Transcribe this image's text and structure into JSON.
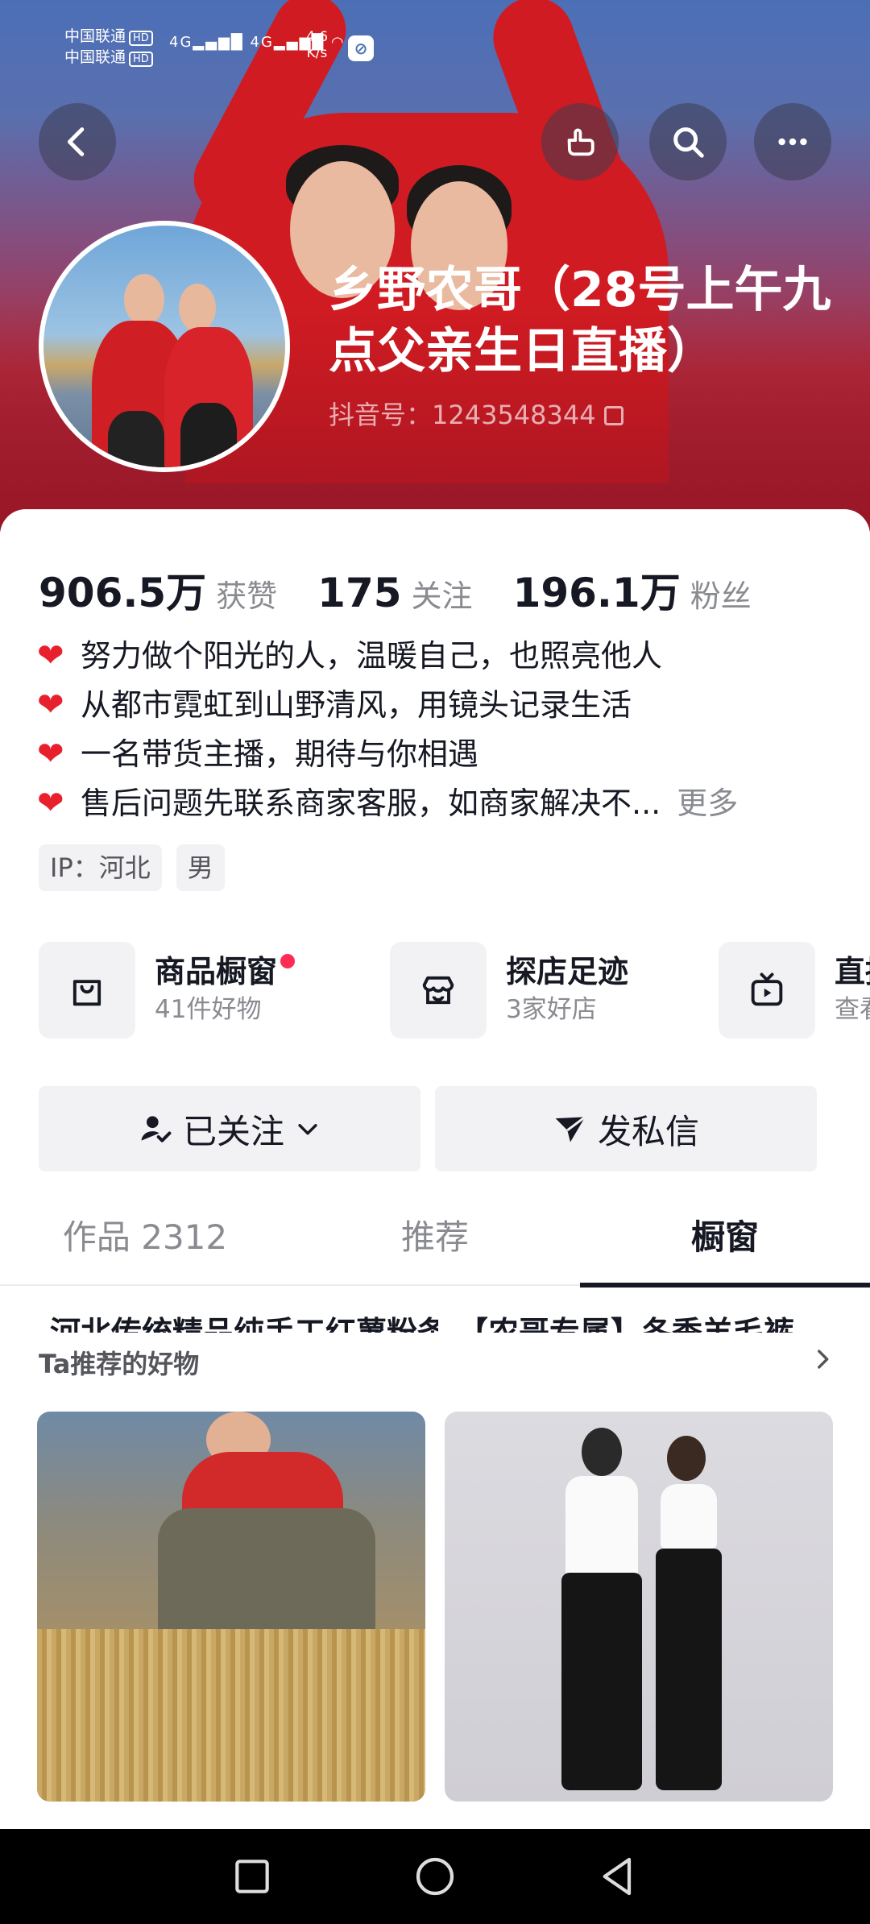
{
  "status_bar": {
    "carrier_1": "中国联通",
    "carrier_2": "中国联通",
    "hd_badge": "HD",
    "network": "4G",
    "speed_value": "4.6",
    "speed_unit": "K/s"
  },
  "header": {
    "nickname": "乡野农哥（28号上午九点父亲生日直播）",
    "douyin_id": "抖音号：1243548344"
  },
  "stats": {
    "likes_value": "906.5万",
    "likes_label": "获赞",
    "following_value": "175",
    "following_label": "关注",
    "fans_value": "196.1万",
    "fans_label": "粉丝"
  },
  "bio": {
    "lines": [
      "努力做个阳光的人，温暖自己，也照亮他人",
      "从都市霓虹到山野清风，用镜头记录生活",
      "一名带货主播，期待与你相遇",
      "售后问题先联系商家客服，如商家解决不..."
    ],
    "more_label": "更多"
  },
  "tags": {
    "ip": "IP：河北",
    "gender": "男"
  },
  "features": {
    "shop_title": "商品橱窗",
    "shop_sub": "41件好物",
    "explore_title": "探店足迹",
    "explore_sub": "3家好店",
    "live_title": "直播",
    "live_sub": "查看"
  },
  "actions": {
    "follow_label": "已关注",
    "message_label": "发私信"
  },
  "tabs": {
    "works": "作品 2312",
    "recommend": "推荐",
    "showcase": "橱窗"
  },
  "showcase": {
    "section_title": "Ta推荐的好物",
    "products": [
      {
        "title": "河北传统精品纯手工红薯粉条"
      },
      {
        "title": "【农哥专属】冬季羊毛裤"
      }
    ]
  },
  "colors": {
    "accent_red": "#fe2c55",
    "heart_red": "#e8202e",
    "text_primary": "#161823",
    "text_secondary": "#8a8b91"
  }
}
